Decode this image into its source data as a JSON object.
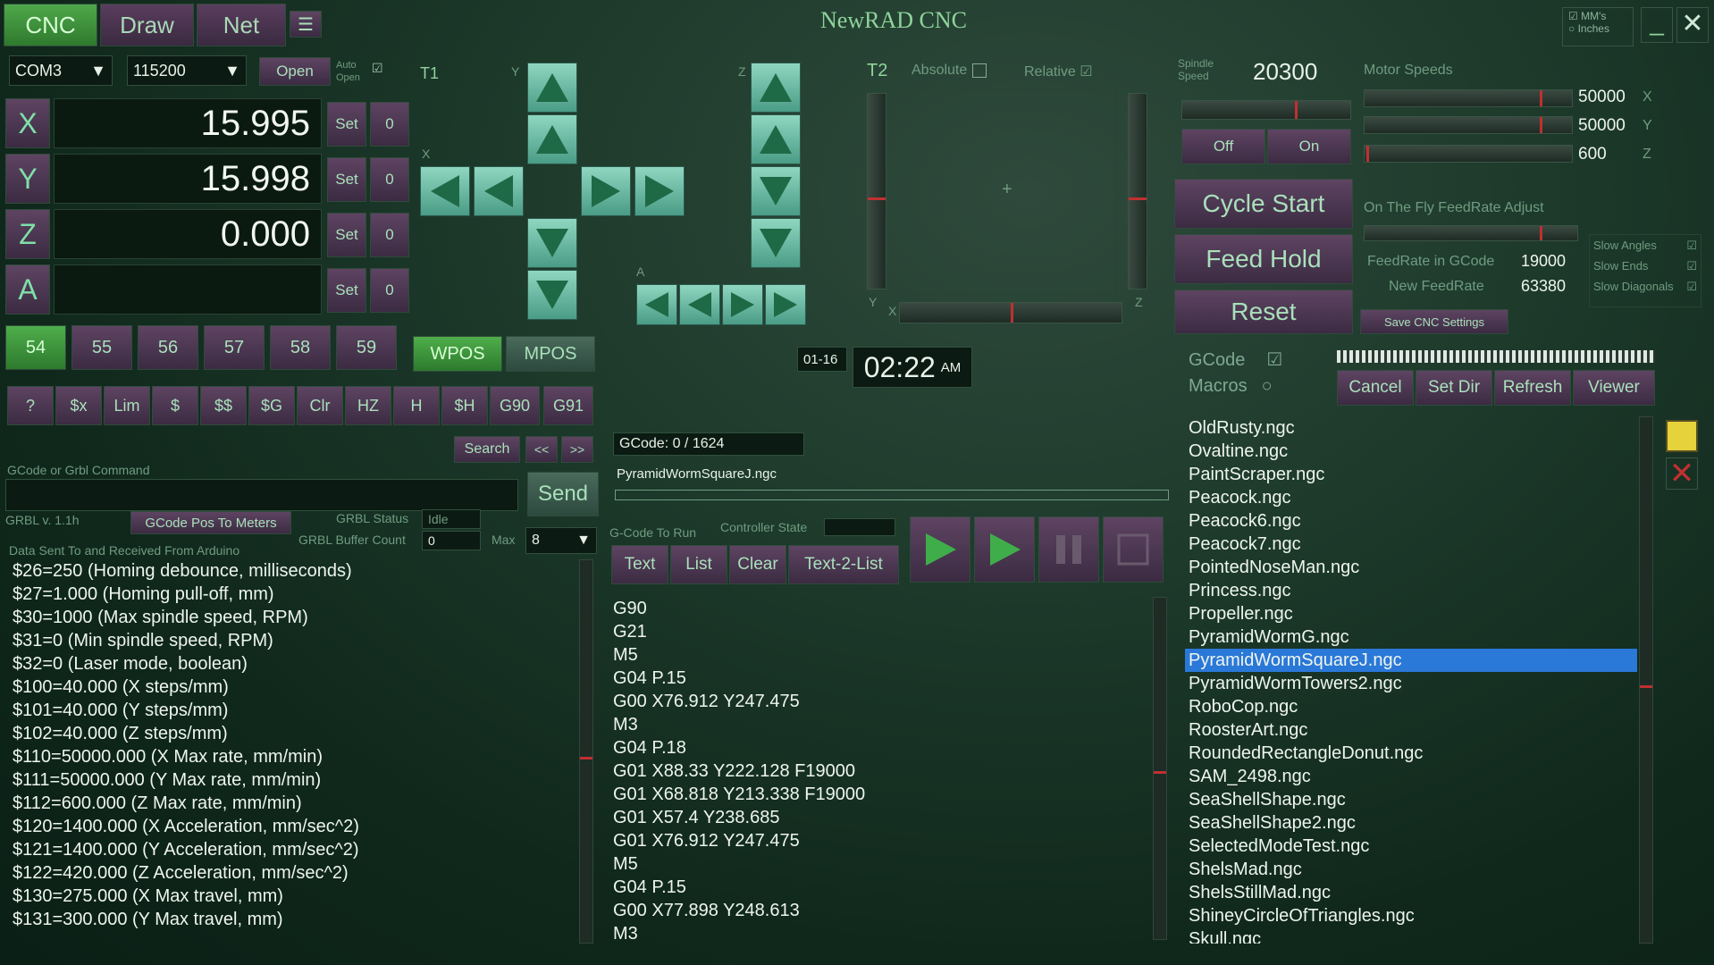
{
  "tabs": [
    "CNC",
    "Draw",
    "Net"
  ],
  "title": "NewRAD CNC",
  "units": {
    "mm": "MM's",
    "inches": "Inches"
  },
  "port": {
    "com": "COM3",
    "baud": "115200",
    "open": "Open",
    "auto_open": "Auto Open"
  },
  "axes": [
    {
      "label": "X",
      "value": "15.995",
      "set": "Set",
      "zero": "0"
    },
    {
      "label": "Y",
      "value": "15.998",
      "set": "Set",
      "zero": "0"
    },
    {
      "label": "Z",
      "value": "0.000",
      "set": "Set",
      "zero": "0"
    },
    {
      "label": "A",
      "value": "",
      "set": "Set",
      "zero": "0"
    }
  ],
  "wcs": [
    "54",
    "55",
    "56",
    "57",
    "58",
    "59"
  ],
  "pos_buttons": {
    "wpos": "WPOS",
    "mpos": "MPOS"
  },
  "cmd_buttons": [
    "?",
    "$x",
    "Lim",
    "$",
    "$$",
    "$G",
    "Clr",
    "HZ",
    "H",
    "$H",
    "G90",
    "G91"
  ],
  "jog": {
    "t1": "T1",
    "y": "Y",
    "x": "X",
    "z": "Z",
    "a": "A"
  },
  "t2": {
    "label": "T2",
    "absolute": "Absolute",
    "relative": "Relative",
    "y": "Y",
    "x": "X",
    "z": "Z"
  },
  "spindle": {
    "label": "Spindle Speed",
    "value": "20300",
    "off": "Off",
    "on": "On"
  },
  "motor": {
    "label": "Motor Speeds",
    "x": "50000",
    "y": "50000",
    "z": "600",
    "xl": "X",
    "yl": "Y",
    "zl": "Z"
  },
  "cycle": {
    "start": "Cycle Start",
    "hold": "Feed Hold",
    "reset": "Reset"
  },
  "feed": {
    "label": "On The Fly FeedRate Adjust",
    "in_gcode_label": "FeedRate in GCode",
    "in_gcode": "19000",
    "new_label": "New FeedRate",
    "new": "63380",
    "save": "Save CNC Settings"
  },
  "slow": {
    "angles": "Slow Angles",
    "ends": "Slow Ends",
    "diagonals": "Slow Diagonals"
  },
  "clock": {
    "date": "01-16",
    "time": "02:22",
    "ampm": "AM"
  },
  "console": {
    "search": "Search",
    "prev": "<<",
    "next": ">>",
    "cmd_label": "GCode or Grbl Command",
    "send": "Send",
    "grbl_version": "GRBL v. 1.1h",
    "pos_to_meters": "GCode Pos To Meters",
    "status_label": "GRBL Status",
    "status": "Idle",
    "buffer_label": "GRBL Buffer Count",
    "buffer": "0",
    "max_label": "Max",
    "max": "8",
    "log_label": "Data Sent To and Received From Arduino"
  },
  "log": [
    "$26=250 (Homing debounce, milliseconds)",
    "$27=1.000 (Homing pull-off, mm)",
    "$30=1000 (Max spindle speed, RPM)",
    "$31=0 (Min spindle speed, RPM)",
    "$32=0 (Laser mode, boolean)",
    "$100=40.000 (X steps/mm)",
    "$101=40.000 (Y steps/mm)",
    "$102=40.000 (Z steps/mm)",
    "$110=50000.000 (X Max rate, mm/min)",
    "$111=50000.000 (Y Max rate, mm/min)",
    "$112=600.000 (Z Max rate, mm/min)",
    "$120=1400.000 (X Acceleration, mm/sec^2)",
    "$121=1400.000 (Y Acceleration, mm/sec^2)",
    "$122=420.000 (Z Acceleration, mm/sec^2)",
    "$130=275.000 (X Max travel, mm)",
    "$131=300.000 (Y Max travel, mm)"
  ],
  "gcode": {
    "progress": "GCode: 0 / 1624",
    "file": "PyramidWormSquareJ.ngc",
    "to_run": "G-Code To Run",
    "controller_state": "Controller State",
    "text": "Text",
    "list": "List",
    "clear": "Clear",
    "text2list": "Text-2-List"
  },
  "gcode_lines": [
    "G90",
    "G21",
    "M5",
    "G04 P.15",
    "G00 X76.912 Y247.475",
    "M3",
    "G04 P.18",
    "G01 X88.33 Y222.128 F19000",
    "G01 X68.818 Y213.338 F19000",
    "G01 X57.4 Y238.685",
    "G01 X76.912 Y247.475",
    "M5",
    "G04 P.15",
    "G00 X77.898 Y248.613",
    "M3"
  ],
  "files": {
    "gcode": "GCode",
    "macros": "Macros",
    "cancel": "Cancel",
    "setdir": "Set Dir",
    "refresh": "Refresh",
    "viewer": "Viewer"
  },
  "file_list": [
    "OldRusty.ngc",
    "Ovaltine.ngc",
    "PaintScraper.ngc",
    "Peacock.ngc",
    "Peacock6.ngc",
    "Peacock7.ngc",
    "PointedNoseMan.ngc",
    "Princess.ngc",
    "Propeller.ngc",
    "PyramidWormG.ngc",
    "PyramidWormSquareJ.ngc",
    "PyramidWormTowers2.ngc",
    "RoboCop.ngc",
    "RoosterArt.ngc",
    "RoundedRectangleDonut.ngc",
    "SAM_2498.ngc",
    "SeaShellShape.ngc",
    "SeaShellShape2.ngc",
    "SelectedModeTest.ngc",
    "ShelsMad.ngc",
    "ShelsStillMad.ngc",
    "ShineyCircleOfTriangles.ngc",
    "Skull.ngc"
  ],
  "selected_file": 10
}
